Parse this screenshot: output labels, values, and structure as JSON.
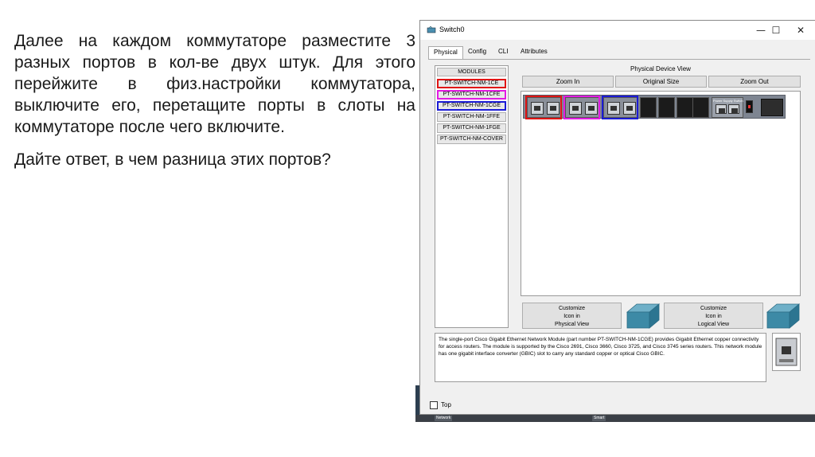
{
  "slide": {
    "paragraph1": "Далее на каждом коммутаторе разместите 3 разных портов в кол-ве двух штук. Для этого перейжите в физ.настройки коммутатора, выключите его, перетащите порты в слоты на коммутаторе после чего включите.",
    "paragraph2": "Дайте ответ, в чем разница этих портов?"
  },
  "window": {
    "title": "Switch0",
    "minimize": "—",
    "maximize": "☐",
    "close": "✕"
  },
  "tabs": [
    "Physical",
    "Config",
    "CLI",
    "Attributes"
  ],
  "modules": {
    "header": "MODULES",
    "items": [
      "PT-SWITCH-NM-1CE",
      "PT-SWITCH-NM-1CFE",
      "PT-SWITCH-NM-1CGE",
      "PT-SWITCH-NM-1FFE",
      "PT-SWITCH-NM-1FGE",
      "PT-SWITCH-NM-COVER"
    ]
  },
  "physical_view": {
    "title": "Physical Device View",
    "zoom_in": "Zoom In",
    "original_size": "Original Size",
    "zoom_out": "Zoom Out",
    "psu_label": "Power Supply Switch"
  },
  "customize": {
    "physical": "Customize\nIcon in\nPhysical View",
    "logical": "Customize\nIcon in\nLogical View"
  },
  "description": "The single-port Cisco Gigabit Ethernet Network Module (part number PT-SWITCH-NM-1CGE) provides Gigabit Ethernet copper connectivity for access routers. The module is supported by the Cisco 2691, Cisco 3660, Cisco 3725, and Cisco 3745 series routers. This network module has one gigabit interface converter (GBIC) slot to carry any standard copper or optical Cisco GBIC.",
  "top_label": "Top",
  "taskbar": [
    "Network",
    "Smart"
  ],
  "colors": {
    "highlight_red": "#e01414",
    "highlight_magenta": "#e31be3",
    "highlight_blue": "#1b1bd6",
    "arrow": "#e01414"
  }
}
